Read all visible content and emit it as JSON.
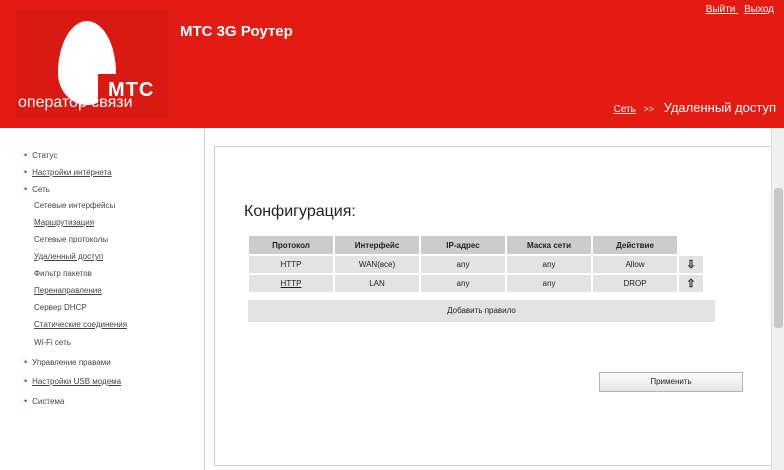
{
  "header": {
    "brand": "МТС",
    "operator": "оператор связи",
    "app_title": "МТС 3G Роутер",
    "top_links": [
      "Выйти",
      "Выход"
    ],
    "breadcrumb": {
      "parent": "Сеть",
      "separator": ">>",
      "current": "Удаленный доступ"
    },
    "brand_color": "#e41b13"
  },
  "sidebar": {
    "items": [
      {
        "label": "Статус",
        "level": "top",
        "link": false
      },
      {
        "label": "Настройки интернета",
        "level": "top",
        "link": true
      },
      {
        "label": "Сеть",
        "level": "top",
        "link": false
      },
      {
        "label": "Сетевые интерфейсы",
        "level": "sub",
        "link": false
      },
      {
        "label": "Маршрутизация",
        "level": "sub",
        "link": true
      },
      {
        "label": "Сетевые протоколы",
        "level": "sub",
        "link": false
      },
      {
        "label": "Удаленный доступ",
        "level": "sub",
        "link": true
      },
      {
        "label": "Фильтр пакетов",
        "level": "sub",
        "link": false
      },
      {
        "label": "Перенаправление",
        "level": "sub",
        "link": true
      },
      {
        "label": "Сервер DHCP",
        "level": "sub",
        "link": false
      },
      {
        "label": "Статические соединения",
        "level": "sub",
        "link": true
      },
      {
        "label": "Wi-Fi сеть",
        "level": "sub",
        "link": false
      },
      {
        "label": "Управление правами",
        "level": "top",
        "link": false
      },
      {
        "label": "Настройки USB модема",
        "level": "top",
        "link": true
      },
      {
        "label": "Система",
        "level": "top",
        "link": false
      }
    ]
  },
  "main": {
    "title": "Конфигурация:",
    "table": {
      "headers": [
        "Протокол",
        "Интерфейс",
        "IP-адрес",
        "Маска сети",
        "Действие"
      ],
      "rows": [
        {
          "protocol": "HTTP",
          "interface": "WAN(все)",
          "ip": "any",
          "mask": "any",
          "action": "Allow"
        },
        {
          "protocol": "HTTP",
          "interface": "LAN",
          "ip": "any",
          "mask": "any",
          "action": "DROP"
        }
      ],
      "add_label": "Добавить правило"
    },
    "apply_label": "Применить"
  }
}
